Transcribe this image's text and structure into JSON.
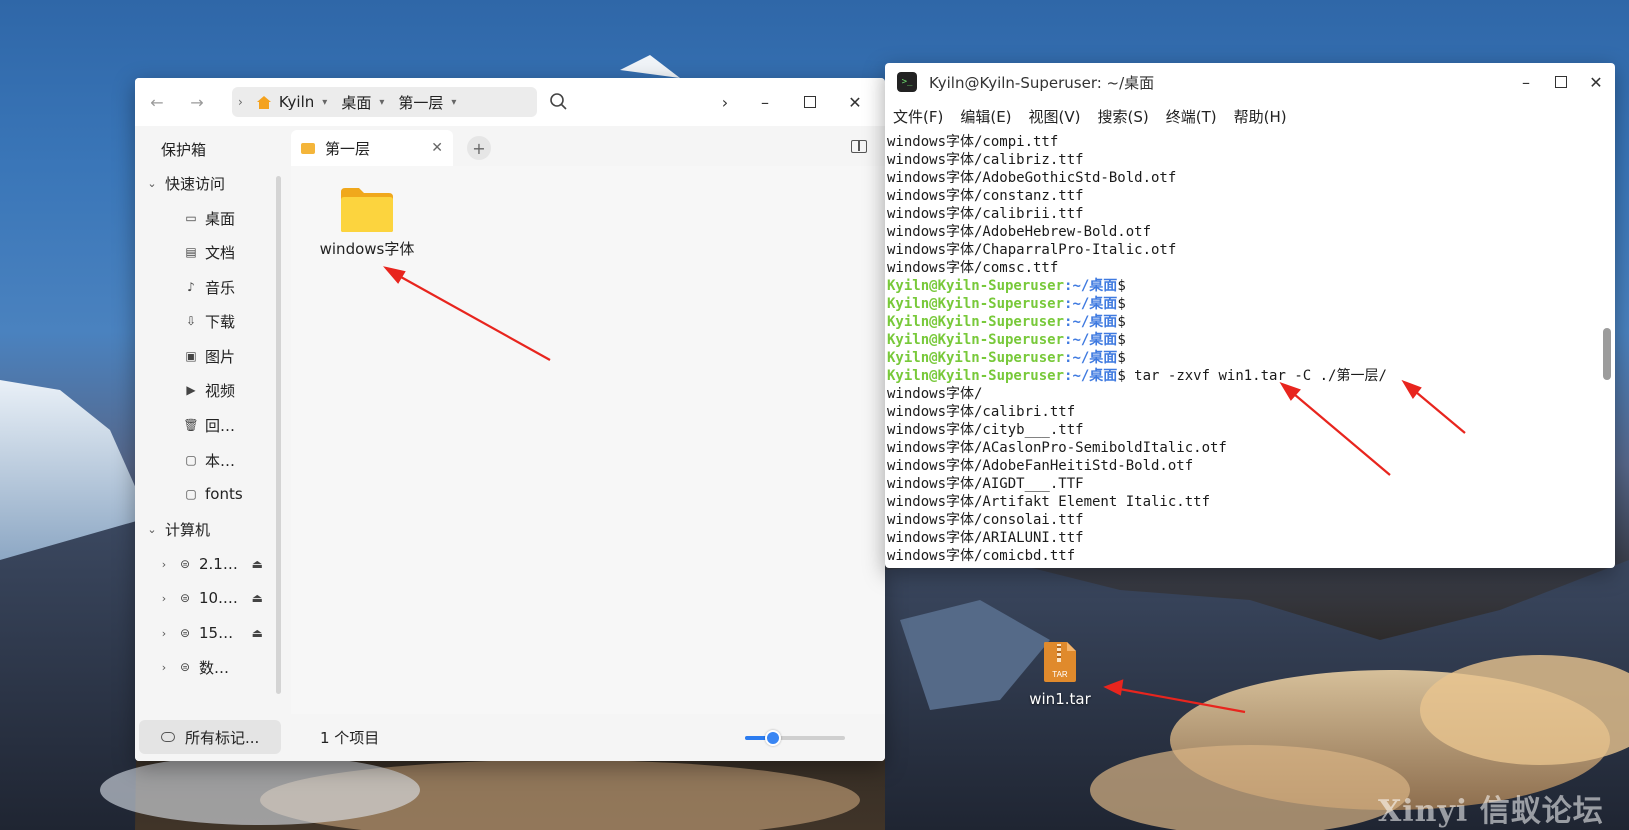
{
  "file_manager": {
    "breadcrumb": [
      {
        "label": "Kyiln"
      },
      {
        "label": "桌面"
      },
      {
        "label": "第一层"
      }
    ],
    "sidebar": {
      "vault": "保护箱",
      "quick_access": "快速访问",
      "quick_items": [
        {
          "label": "桌面",
          "icon": "desktop-icon"
        },
        {
          "label": "文档",
          "icon": "document-icon"
        },
        {
          "label": "音乐",
          "icon": "music-icon"
        },
        {
          "label": "下载",
          "icon": "download-icon"
        },
        {
          "label": "图片",
          "icon": "picture-icon"
        },
        {
          "label": "视频",
          "icon": "video-icon"
        },
        {
          "label": "回…",
          "icon": "trash-icon"
        },
        {
          "label": "本…",
          "icon": "folder-icon"
        },
        {
          "label": "fonts",
          "icon": "folder-icon"
        }
      ],
      "computer": "计算机",
      "drives": [
        {
          "label": "2.1…",
          "eject": "⏏"
        },
        {
          "label": "10.…",
          "eject": "⏏"
        },
        {
          "label": "15…",
          "eject": "⏏"
        },
        {
          "label": "数…",
          "eject": ""
        }
      ],
      "all_tags": "所有标记..."
    },
    "tab": {
      "label": "第一层"
    },
    "items": [
      {
        "name": "windows字体",
        "type": "folder"
      }
    ],
    "status": "1 个项目",
    "zoom_level": 0.28
  },
  "terminal": {
    "title": "Kyiln@Kyiln-Superuser: ~/桌面",
    "menu": [
      "文件(F)",
      "编辑(E)",
      "视图(V)",
      "搜索(S)",
      "终端(T)",
      "帮助(H)"
    ],
    "prompt_user": "Kyiln@Kyiln-Superuser",
    "prompt_path": ":~/桌面",
    "prompt_symbol": "$",
    "lines_before": [
      "windows字体/compi.ttf",
      "windows字体/calibriz.ttf",
      "windows字体/AdobeGothicStd-Bold.otf",
      "windows字体/constanz.ttf",
      "windows字体/calibrii.ttf",
      "windows字体/AdobeHebrew-Bold.otf",
      "windows字体/ChaparralPro-Italic.otf",
      "windows字体/comsc.ttf"
    ],
    "empty_prompts": 5,
    "command": " tar -zxvf win1.tar -C ./第一层/",
    "lines_after": [
      "windows字体/",
      "windows字体/calibri.ttf",
      "windows字体/cityb___.ttf",
      "windows字体/ACaslonPro-SemiboldItalic.otf",
      "windows字体/AdobeFanHeitiStd-Bold.otf",
      "windows字体/AIGDT___.TTF",
      "windows字体/Artifakt Element Italic.ttf",
      "windows字体/consolai.ttf",
      "windows字体/ARIALUNI.ttf",
      "windows字体/comicbd.ttf"
    ]
  },
  "desktop": {
    "file_label": "win1.tar",
    "file_badge": "TAR",
    "watermark": "Xinyi 信蚁论坛"
  },
  "colors": {
    "arrow": "#e8251e",
    "prompt_user": "#78c93a",
    "prompt_path": "#3f7ae0",
    "accent": "#2b7cf0",
    "folder": "#f4b53a"
  }
}
